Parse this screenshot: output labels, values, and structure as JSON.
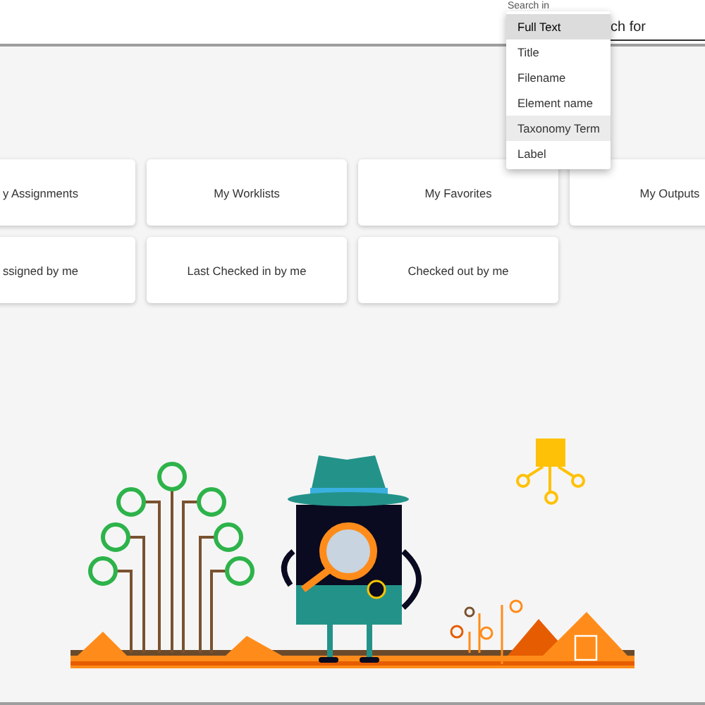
{
  "search": {
    "scope_label": "Search in",
    "placeholder": "ch for"
  },
  "scope_menu": [
    {
      "label": "Full Text",
      "selected": true,
      "hovered": false
    },
    {
      "label": "Title",
      "selected": false,
      "hovered": false
    },
    {
      "label": "Filename",
      "selected": false,
      "hovered": false
    },
    {
      "label": "Element name",
      "selected": false,
      "hovered": false
    },
    {
      "label": "Taxonomy Term",
      "selected": false,
      "hovered": true
    },
    {
      "label": "Label",
      "selected": false,
      "hovered": false
    }
  ],
  "tiles": [
    "y Assignments",
    "My Worklists",
    "My Favorites",
    "My Outputs",
    "ssigned by me",
    "Last Checked in by me",
    "Checked out by me"
  ]
}
